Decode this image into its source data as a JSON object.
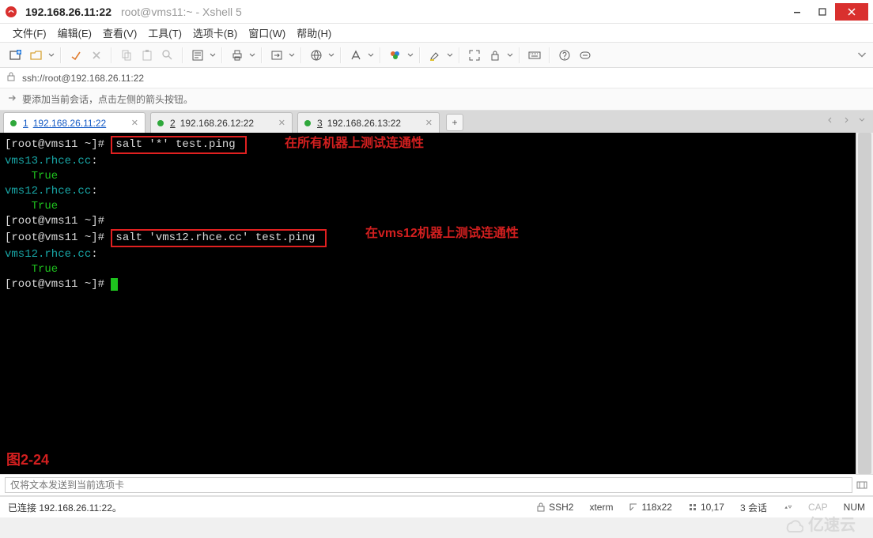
{
  "title": {
    "ip": "192.168.26.11:22",
    "sub": "root@vms11:~ - Xshell 5"
  },
  "menu": {
    "file": "文件(F)",
    "edit": "编辑(E)",
    "view": "查看(V)",
    "tool": "工具(T)",
    "tab": "选项卡(B)",
    "window": "窗口(W)",
    "help": "帮助(H)"
  },
  "addr": {
    "url": "ssh://root@192.168.26.11:22"
  },
  "hint": {
    "text": "要添加当前会话，点击左侧的箭头按钮。"
  },
  "tabs": {
    "t1_num": "1",
    "t1_label": "192.168.26.11:22",
    "t2_num": "2",
    "t2_label": "192.168.26.12:22",
    "t3_num": "3",
    "t3_label": "192.168.26.13:22",
    "add": "+"
  },
  "term": {
    "prompt1a": "[root@vms11 ~]# ",
    "cmd1": "salt '*' test.ping ",
    "annot1": "在所有机器上测试连通性",
    "l2": "vms13.rhce.cc",
    "l2b": ":",
    "l3": "    True",
    "l4": "vms12.rhce.cc",
    "l4b": ":",
    "l5": "    True",
    "prompt2": "[root@vms11 ~]#",
    "prompt3a": "[root@vms11 ~]# ",
    "cmd2": "salt 'vms12.rhce.cc' test.ping ",
    "annot2": "在vms12机器上测试连通性",
    "l8": "vms12.rhce.cc",
    "l8b": ":",
    "l9": "    True",
    "prompt4": "[root@vms11 ~]# ",
    "figlabel": "图2-24"
  },
  "cmdline": {
    "placeholder": "仅将文本发送到当前选项卡"
  },
  "status": {
    "left": "已连接 192.168.26.11:22。",
    "ssh": "SSH2",
    "term": "xterm",
    "size": "118x22",
    "cursor": "10,17",
    "sessions": "3 会话",
    "cap": "CAP",
    "num": "NUM"
  },
  "watermark": {
    "text": "亿速云"
  }
}
